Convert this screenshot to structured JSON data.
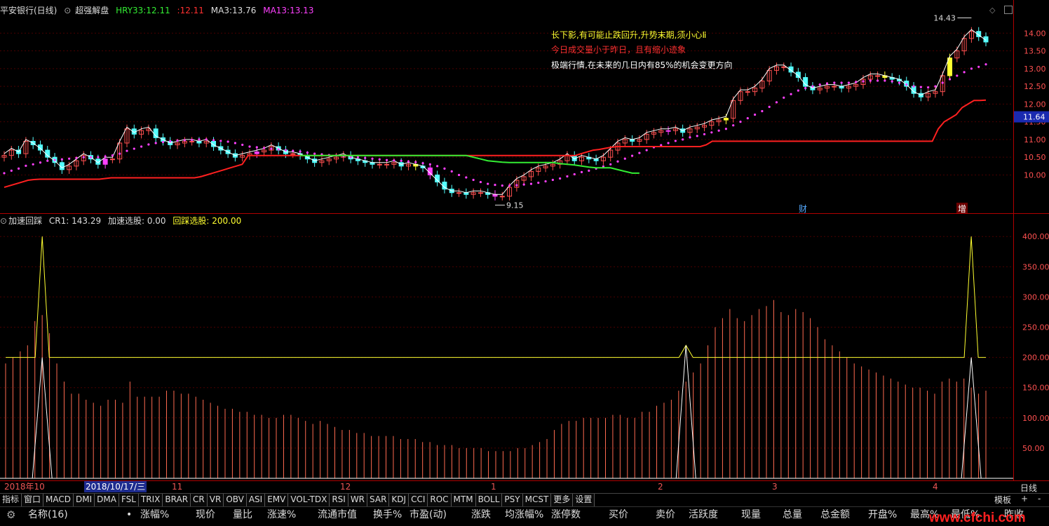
{
  "header": {
    "stock_name": "平安银行(日线)",
    "indicator_name": "超强解盘",
    "hry33_label": "HRY33:",
    "hry33_value": "12.11",
    "second_value": ":12.11",
    "ma3_label": "MA3:",
    "ma3_value": "13.76",
    "ma13_label": "MA13:",
    "ma13_value": "13.13"
  },
  "sub_header": {
    "title": "加速回踩",
    "cr_label": "CR1:",
    "cr_value": "143.29",
    "accel_label": "加速选股:",
    "accel_value": "0.00",
    "pullback_label": "回踩选股:",
    "pullback_value": "200.00"
  },
  "annotations": {
    "line1": "长下影,有可能止跌回升,升势末期,须小心Ⅱ",
    "line2": "今日成交量小于昨日，且有缩小迹象",
    "line3": "极端行情,在未来的几日内有85%的机会变更方向",
    "high_label": "14.43",
    "low_label": "9.15",
    "marker_cai": "财",
    "marker_zeng": "增",
    "current_price": "11.64"
  },
  "date_axis": {
    "labels": [
      "2018年10",
      "2018/10/17/三",
      "11",
      "12",
      "1",
      "2",
      "3",
      "4"
    ],
    "period_button": "日线"
  },
  "tabs": [
    "指标",
    "窗口",
    "MACD",
    "DMI",
    "DMA",
    "FSL",
    "TRIX",
    "BRAR",
    "CR",
    "VR",
    "OBV",
    "ASI",
    "EMV",
    "VOL-TDX",
    "RSI",
    "WR",
    "SAR",
    "KDJ",
    "CCI",
    "ROC",
    "MTM",
    "BOLL",
    "PSY",
    "MCST",
    "更多",
    "设置"
  ],
  "tab_right": {
    "template": "模板",
    "plus": "+",
    "minus": "-"
  },
  "columns": {
    "name": "名称(16)",
    "dot": "•",
    "items": [
      "涨幅%",
      "现价",
      "量比",
      "涨速%",
      "流通市值",
      "换手%",
      "市盈(动)",
      "涨跌",
      "均涨幅%",
      "涨停数",
      "买价",
      "卖价",
      "活跃度",
      "现量",
      "总量",
      "总金额",
      "开盘%",
      "最高%",
      "最低%",
      "昨收"
    ]
  },
  "watermark": "www.cfchi.com",
  "colors": {
    "up": "#ff5050",
    "down": "#54ffff",
    "ma13": "#ff40ff",
    "green": "#33ee33",
    "red_line": "#ff2020",
    "yellow": "#ffff30",
    "grid": "#4a0000",
    "axis": "#b00000"
  },
  "chart_data": [
    {
      "type": "candlestick",
      "title": "超强解盘",
      "y_ticks": [
        10.0,
        10.5,
        11.0,
        11.5,
        12.0,
        12.5,
        13.0,
        13.5,
        14.0
      ],
      "ylim": [
        9.0,
        14.5
      ],
      "high": 14.43,
      "low": 9.15,
      "current": 11.64,
      "close": [
        10.55,
        10.7,
        10.6,
        10.95,
        10.85,
        10.7,
        10.5,
        10.35,
        10.15,
        10.25,
        10.4,
        10.55,
        10.45,
        10.3,
        10.45,
        10.45,
        10.9,
        11.3,
        11.15,
        11.25,
        11.3,
        11.05,
        10.95,
        10.85,
        10.9,
        10.95,
        10.95,
        10.9,
        10.95,
        10.8,
        10.7,
        10.6,
        10.5,
        10.55,
        10.6,
        10.65,
        10.7,
        10.8,
        10.7,
        10.6,
        10.6,
        10.55,
        10.45,
        10.35,
        10.4,
        10.45,
        10.5,
        10.55,
        10.45,
        10.4,
        10.35,
        10.3,
        10.3,
        10.3,
        10.35,
        10.25,
        10.3,
        10.25,
        10.2,
        10.0,
        9.8,
        9.6,
        9.5,
        9.5,
        9.45,
        9.5,
        9.5,
        9.45,
        9.4,
        9.4,
        9.65,
        9.85,
        9.95,
        10.1,
        10.2,
        10.25,
        10.3,
        10.4,
        10.55,
        10.4,
        10.5,
        10.45,
        10.4,
        10.5,
        10.7,
        10.9,
        11.0,
        10.95,
        11.0,
        11.15,
        11.2,
        11.25,
        11.25,
        11.3,
        11.2,
        11.3,
        11.35,
        11.4,
        11.5,
        11.55,
        11.6,
        12.1,
        12.35,
        12.35,
        12.45,
        12.65,
        12.95,
        13.05,
        13.05,
        12.9,
        12.75,
        12.5,
        12.4,
        12.45,
        12.5,
        12.5,
        12.45,
        12.5,
        12.55,
        12.7,
        12.8,
        12.8,
        12.75,
        12.7,
        12.65,
        12.5,
        12.3,
        12.2,
        12.3,
        12.35,
        12.8,
        13.3,
        13.5,
        13.85,
        14.05,
        13.9,
        13.75
      ],
      "ma13": [
        10.05,
        10.12,
        10.18,
        10.26,
        10.3,
        10.35,
        10.4,
        10.42,
        10.44,
        10.46,
        10.48,
        10.5,
        10.5,
        10.5,
        10.52,
        10.55,
        10.6,
        10.68,
        10.74,
        10.8,
        10.86,
        10.9,
        10.93,
        10.95,
        10.97,
        10.98,
        10.99,
        11.0,
        11.0,
        10.98,
        10.96,
        10.94,
        10.9,
        10.85,
        10.8,
        10.78,
        10.76,
        10.74,
        10.72,
        10.7,
        10.68,
        10.66,
        10.63,
        10.6,
        10.58,
        10.56,
        10.55,
        10.53,
        10.5,
        10.5,
        10.48,
        10.46,
        10.44,
        10.42,
        10.41,
        10.4,
        10.38,
        10.36,
        10.33,
        10.3,
        10.25,
        10.18,
        10.1,
        10.0,
        9.93,
        9.86,
        9.8,
        9.75,
        9.72,
        9.7,
        9.7,
        9.71,
        9.73,
        9.75,
        9.78,
        9.82,
        9.86,
        9.9,
        9.96,
        10.02,
        10.08,
        10.12,
        10.18,
        10.24,
        10.3,
        10.38,
        10.46,
        10.54,
        10.62,
        10.7,
        10.78,
        10.84,
        10.9,
        10.96,
        11.0,
        11.06,
        11.1,
        11.15,
        11.2,
        11.25,
        11.3,
        11.4,
        11.5,
        11.6,
        11.7,
        11.8,
        11.92,
        12.05,
        12.18,
        12.28,
        12.38,
        12.45,
        12.5,
        12.55,
        12.58,
        12.6,
        12.6,
        12.6,
        12.62,
        12.64,
        12.66,
        12.66,
        12.66,
        12.64,
        12.6,
        12.55,
        12.5,
        12.48,
        12.47,
        12.5,
        12.6,
        12.7,
        12.8,
        12.9,
        13.0,
        13.05,
        13.12
      ],
      "hry33": [
        9.65,
        9.7,
        9.75,
        9.8,
        9.85,
        9.87,
        9.88,
        9.88,
        9.88,
        9.88,
        9.88,
        9.88,
        9.88,
        9.88,
        9.88,
        9.88,
        9.88,
        9.9,
        9.92,
        9.92,
        9.92,
        9.92,
        9.92,
        9.92,
        9.92,
        9.92,
        9.92,
        9.92,
        9.92,
        9.92,
        9.92,
        9.92,
        9.92,
        9.95,
        10.0,
        10.05,
        10.1,
        10.15,
        10.2,
        10.25,
        10.3,
        10.55,
        10.55,
        10.55,
        10.55,
        10.55,
        10.55,
        10.55,
        10.55,
        10.55,
        10.55,
        10.55,
        10.55,
        10.55,
        10.55,
        10.55,
        10.55,
        10.55,
        10.55,
        10.55,
        10.55,
        10.55,
        10.55,
        10.55,
        10.55,
        10.55,
        10.55,
        10.55,
        10.55,
        10.55,
        10.55,
        10.55,
        10.55,
        10.55,
        10.55,
        10.55,
        10.55,
        10.55,
        10.55,
        10.55,
        10.55,
        10.55,
        10.55,
        10.55,
        10.55,
        10.55,
        10.55,
        10.55,
        10.55,
        10.55,
        10.55,
        10.55,
        10.55,
        10.55,
        10.55,
        10.55,
        10.55,
        10.6,
        10.65,
        10.7,
        10.72,
        10.75,
        10.78,
        10.8,
        10.8,
        10.8,
        10.8,
        10.8,
        10.8,
        10.8,
        10.8,
        10.8,
        10.8,
        10.8,
        10.8,
        10.8,
        10.8,
        10.8,
        10.85,
        10.95,
        10.95,
        10.95,
        10.95,
        10.95,
        10.95,
        10.95,
        10.95,
        10.95,
        10.95,
        10.95,
        10.95,
        10.95,
        10.95,
        10.95,
        10.95,
        10.95,
        10.95,
        10.95,
        10.95,
        10.95,
        10.95,
        10.95,
        10.95,
        10.95,
        10.95,
        10.95,
        10.95,
        10.95,
        10.95,
        10.95,
        10.95,
        10.95,
        10.95,
        10.95,
        10.95,
        10.95,
        10.95,
        11.3,
        11.5,
        11.6,
        11.7,
        11.9,
        12.0,
        12.1,
        12.1,
        12.11
      ],
      "green_segment": {
        "from_index": 41,
        "to_index": 88,
        "values": [
          10.55,
          10.55,
          10.55,
          10.55,
          10.55,
          10.55,
          10.55,
          10.55,
          10.55,
          10.55,
          10.55,
          10.55,
          10.55,
          10.55,
          10.55,
          10.55,
          10.55,
          10.55,
          10.55,
          10.55,
          10.55,
          10.55,
          10.55,
          10.55,
          10.5,
          10.45,
          10.4,
          10.38,
          10.36,
          10.35,
          10.35,
          10.35,
          10.35,
          10.35,
          10.35,
          10.35,
          10.32,
          10.3,
          10.28,
          10.25,
          10.22,
          10.2,
          10.2,
          10.2,
          10.15,
          10.1,
          10.05,
          10.05
        ]
      },
      "yellow_candles": [
        57,
        100,
        122,
        131
      ],
      "magenta_candles": [
        14,
        35,
        59,
        68,
        92
      ]
    },
    {
      "type": "line+bar",
      "title": "加速回踩",
      "y_ticks": [
        50,
        100,
        150,
        200,
        250,
        300,
        350,
        400
      ],
      "ylim": [
        0,
        420
      ],
      "cr_bars": [
        190,
        200,
        210,
        220,
        260,
        270,
        240,
        190,
        160,
        140,
        140,
        130,
        125,
        120,
        130,
        130,
        125,
        160,
        135,
        135,
        135,
        135,
        145,
        145,
        140,
        140,
        135,
        130,
        125,
        120,
        115,
        115,
        110,
        110,
        105,
        105,
        100,
        100,
        105,
        105,
        100,
        95,
        90,
        95,
        90,
        85,
        80,
        80,
        75,
        75,
        70,
        70,
        70,
        70,
        65,
        65,
        65,
        60,
        60,
        55,
        55,
        55,
        50,
        50,
        50,
        50,
        45,
        45,
        45,
        45,
        50,
        50,
        55,
        60,
        65,
        80,
        90,
        95,
        95,
        100,
        100,
        100,
        100,
        105,
        105,
        100,
        100,
        110,
        110,
        120,
        125,
        130,
        145,
        160,
        175,
        190,
        220,
        250,
        265,
        280,
        265,
        260,
        270,
        280,
        285,
        295,
        275,
        270,
        280,
        275,
        265,
        250,
        230,
        220,
        210,
        200,
        190,
        185,
        180,
        175,
        170,
        165,
        160,
        155,
        150,
        150,
        145,
        140,
        160,
        165,
        160,
        165,
        150,
        140,
        145
      ],
      "pullback": [
        200,
        200,
        200,
        200,
        200,
        200,
        200,
        200,
        200,
        200,
        200,
        200,
        200,
        200,
        200,
        200,
        200,
        200,
        200,
        200,
        200,
        200,
        200,
        200,
        200,
        200,
        200,
        200,
        200,
        200,
        200,
        200,
        200,
        200,
        200,
        200,
        200,
        200,
        200,
        200,
        200,
        200,
        200,
        200,
        200,
        200,
        200,
        200,
        200,
        200,
        200,
        200,
        200,
        200,
        200,
        200,
        200,
        200,
        200,
        200,
        200,
        200,
        200,
        200,
        200,
        200,
        200,
        200,
        200,
        200,
        200,
        200,
        200,
        200,
        200,
        200,
        200,
        200,
        200,
        200,
        200,
        200,
        200,
        200,
        200,
        200,
        200,
        200,
        200,
        200,
        200,
        200,
        200,
        200,
        200,
        200,
        200,
        200,
        200,
        200,
        200,
        200,
        200,
        200,
        200,
        200,
        200,
        200,
        200,
        200,
        200,
        200,
        200,
        200,
        200,
        200,
        200,
        200,
        200,
        200,
        200,
        200,
        200,
        200,
        200,
        200,
        200,
        200,
        200,
        200,
        200,
        200,
        200,
        200,
        200
      ],
      "spikes": [
        {
          "index": 5,
          "value": 400
        },
        {
          "index": 93,
          "value": 220
        },
        {
          "index": 132,
          "value": 400
        }
      ]
    }
  ]
}
